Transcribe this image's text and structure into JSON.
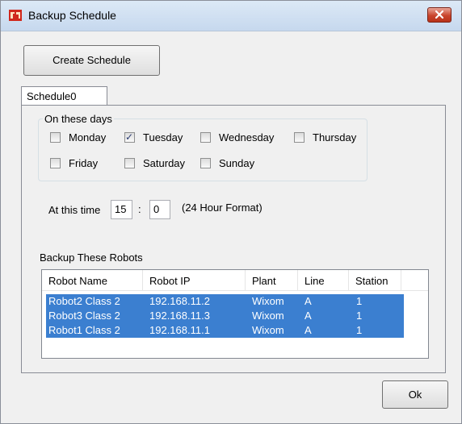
{
  "window": {
    "title": "Backup Schedule"
  },
  "toolbar": {
    "create_label": "Create Schedule"
  },
  "tabs": [
    {
      "label": "Schedule0"
    }
  ],
  "schedule": {
    "days_label": "On these days",
    "days": [
      {
        "label": "Monday",
        "checked": false
      },
      {
        "label": "Tuesday",
        "checked": true
      },
      {
        "label": "Wednesday",
        "checked": false
      },
      {
        "label": "Thursday",
        "checked": false
      },
      {
        "label": "Friday",
        "checked": false
      },
      {
        "label": "Saturday",
        "checked": false
      },
      {
        "label": "Sunday",
        "checked": false
      }
    ],
    "time_label": "At this time",
    "hour": "15",
    "separator": ":",
    "minute": "0",
    "format_note": "(24 Hour Format)",
    "robots_label": "Backup These Robots"
  },
  "robots_table": {
    "columns": [
      "Robot Name",
      "Robot IP",
      "Plant",
      "Line",
      "Station"
    ],
    "rows": [
      [
        "Robot2 Class 2",
        "192.168.11.2",
        "Wixom",
        "A",
        "1"
      ],
      [
        "Robot3 Class 2",
        "192.168.11.3",
        "Wixom",
        "A",
        "1"
      ],
      [
        "Robot1 Class 2",
        "192.168.11.1",
        "Wixom",
        "A",
        "1"
      ]
    ],
    "selection_color": "#3b7fd0"
  },
  "footer": {
    "ok_label": "Ok"
  },
  "icons": {
    "close": "close-icon",
    "app": "robot-app-icon"
  }
}
